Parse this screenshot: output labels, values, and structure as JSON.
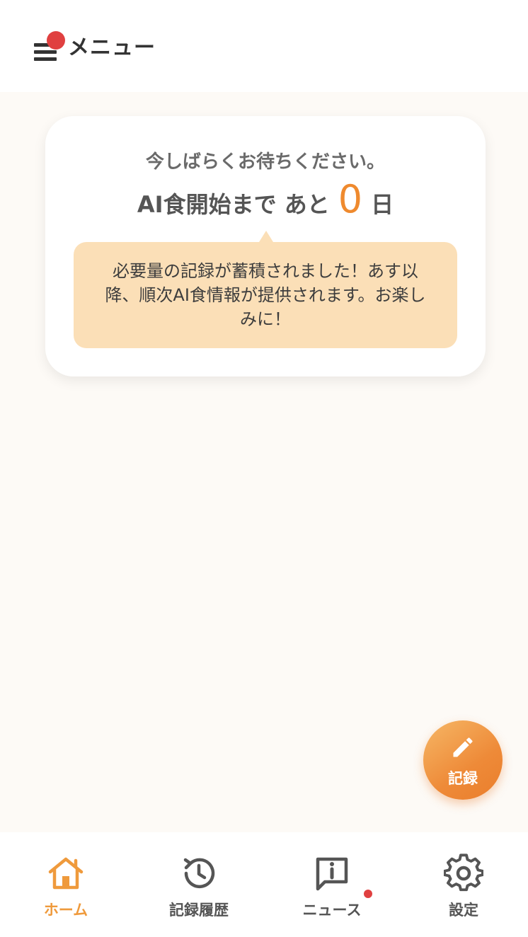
{
  "header": {
    "menu_label": "メニュー"
  },
  "card": {
    "wait_message": "今しばらくお待ちください。",
    "countdown_prefix": "AI食開始まで あと",
    "countdown_days": "0",
    "countdown_unit": "日",
    "notice": "必要量の記録が蓄積されました！あす以降、順次AI食情報が提供されます。お楽しみに！"
  },
  "fab": {
    "label": "記録",
    "icon": "pencil-icon"
  },
  "tabs": [
    {
      "label": "ホーム",
      "icon": "home-icon",
      "active": true
    },
    {
      "label": "記録履歴",
      "icon": "history-icon",
      "active": false
    },
    {
      "label": "ニュース",
      "icon": "news-icon",
      "active": false
    },
    {
      "label": "設定",
      "icon": "gear-icon",
      "active": false
    }
  ],
  "colors": {
    "accent": "#ef8a2e",
    "bubble": "#fbdfb7",
    "notification": "#e04040"
  }
}
